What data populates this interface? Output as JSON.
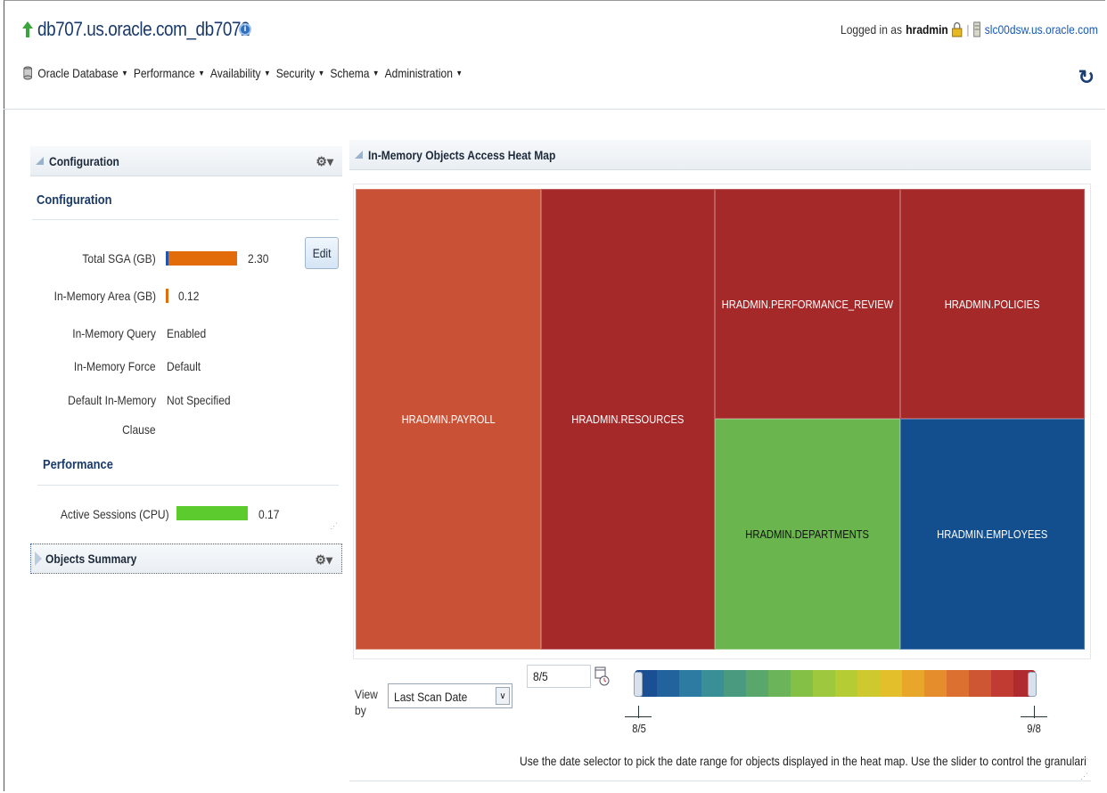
{
  "header": {
    "db_title": "db707.us.oracle.com_db7072",
    "logged_in_prefix": "Logged in as",
    "user": "hradmin",
    "host": "slc00dsw.us.oracle.com"
  },
  "menu": [
    {
      "label": "Oracle Database"
    },
    {
      "label": "Performance"
    },
    {
      "label": "Availability"
    },
    {
      "label": "Security"
    },
    {
      "label": "Schema"
    },
    {
      "label": "Administration"
    }
  ],
  "config_panel": {
    "header": "Configuration",
    "section_config": "Configuration",
    "rows": {
      "total_sga_label": "Total SGA (GB)",
      "total_sga_value": "2.30",
      "inmem_area_label": "In-Memory Area (GB)",
      "inmem_area_value": "0.12",
      "inmem_query_label": "In-Memory Query",
      "inmem_query_value": "Enabled",
      "inmem_force_label": "In-Memory Force",
      "inmem_force_value": "Default",
      "default_clause_label_1": "Default In-Memory",
      "default_clause_label_2": "Clause",
      "default_clause_value": "Not Specified"
    },
    "edit_label": "Edit",
    "section_perf": "Performance",
    "active_sessions_label": "Active Sessions (CPU)",
    "active_sessions_value": "0.17"
  },
  "objects_summary": {
    "header": "Objects Summary"
  },
  "heatmap": {
    "header": "In-Memory Objects Access Heat Map",
    "cells": [
      {
        "label": "HRADMIN.PAYROLL",
        "color": "#c85136"
      },
      {
        "label": "HRADMIN.RESOURCES",
        "color": "#a6292a"
      },
      {
        "label": "HRADMIN.PERFORMANCE_REVIEW",
        "color": "#a6292a"
      },
      {
        "label": "HRADMIN.POLICIES",
        "color": "#a6292a"
      },
      {
        "label": "HRADMIN.DEPARTMENTS",
        "color": "#6ab54e"
      },
      {
        "label": "HRADMIN.EMPLOYEES",
        "color": "#134f8f"
      }
    ],
    "view_by_label": "View by",
    "view_by_value": "Last Scan Date",
    "date_value": "8/5",
    "slider_start": "8/5",
    "slider_end": "9/8",
    "help_text": "Use the date selector to pick the date range for objects displayed in the heat map. Use the slider to control the granularity of the color."
  },
  "colors": {
    "sga_bar": "#e36c0a",
    "sga_marker": "#2255aa",
    "cpu_bar": "#5ccb2e",
    "gradient": [
      "#1a4f94",
      "#22639e",
      "#2d7aa3",
      "#3a8e96",
      "#4a9a7f",
      "#5aa76b",
      "#6cb45a",
      "#84bf46",
      "#9ec83d",
      "#b5cc35",
      "#cdc92f",
      "#e2bf2b",
      "#e8a72a",
      "#e58d2c",
      "#db7030",
      "#cf5633",
      "#c23b33",
      "#b02b2f"
    ]
  }
}
